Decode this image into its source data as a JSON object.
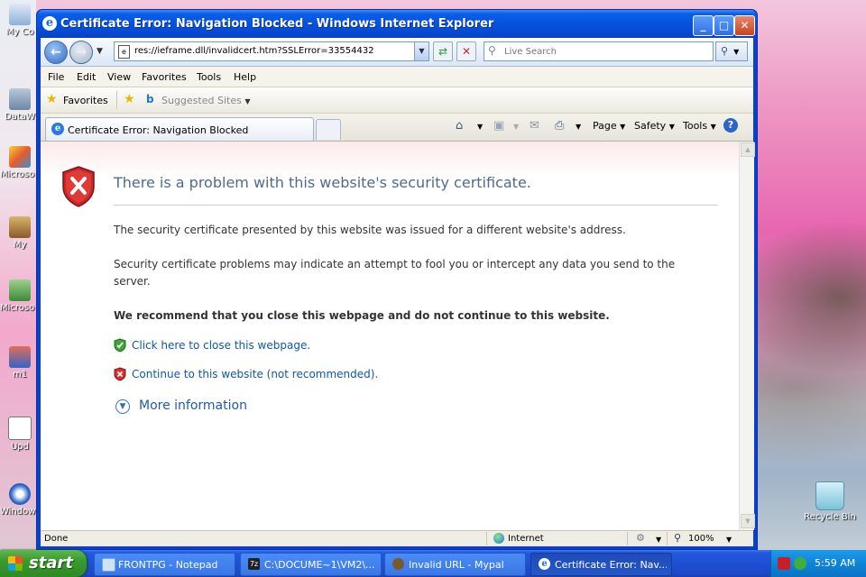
{
  "window": {
    "title": "Certificate Error: Navigation Blocked - Windows Internet Explorer",
    "min": "_",
    "max": "□",
    "close": "✕"
  },
  "address": {
    "url": "res://ieframe.dll/invalidcert.htm?SSLError=33554432",
    "search_placeholder": "Live Search"
  },
  "menu": [
    "File",
    "Edit",
    "View",
    "Favorites",
    "Tools",
    "Help"
  ],
  "favorites": {
    "label": "Favorites",
    "suggested": "Suggested Sites"
  },
  "tab": {
    "label": "Certificate Error: Navigation Blocked"
  },
  "command_bar": {
    "page": "Page",
    "safety": "Safety",
    "tools": "Tools"
  },
  "content": {
    "title": "There is a problem with this website's security certificate.",
    "p1": "The security certificate presented by this website was issued for a different website's address.",
    "p2": "Security certificate problems may indicate an attempt to fool you or intercept any data you send to the server.",
    "recommend": "We recommend that you close this webpage and do not continue to this website.",
    "close_link": "Click here to close this webpage.",
    "continue_link": "Continue to this website (not recommended).",
    "more_info": "More information"
  },
  "status": {
    "text": "Done",
    "zone": "Internet",
    "zoom": "100%"
  },
  "desktop": {
    "icons": [
      "My Co",
      "DataW",
      "Microso C++",
      "My",
      "Microso Basi",
      "m1",
      "Upd",
      "Window Pla"
    ],
    "recycle_bin": "Recycle Bin"
  },
  "taskbar": {
    "start": "start",
    "tasks": [
      {
        "label": "FRONTPG - Notepad"
      },
      {
        "label": "C:\\DOCUME~1\\VM2\\..."
      },
      {
        "label": "Invalid URL - Mypal"
      },
      {
        "label": "Certificate Error: Nav..."
      }
    ],
    "clock": "5:59 AM"
  },
  "colors": {
    "title_text": "#4e6b8c",
    "link": "#0d58a8",
    "titlebar": "#0554e0",
    "start_green": "#3a9a2e"
  }
}
